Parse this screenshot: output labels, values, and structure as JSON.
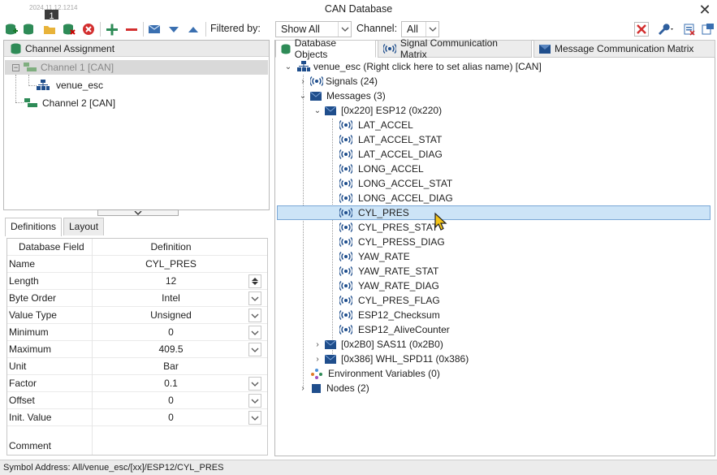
{
  "window": {
    "title": "CAN Database",
    "timestamp": "2024.11.12.1214",
    "badge": "1"
  },
  "toolbar": {
    "filtered_by_label": "Filtered by:",
    "filter_value": "Show All",
    "channel_label": "Channel:",
    "channel_value": "All"
  },
  "left": {
    "channel_assignment_title": "Channel Assignment",
    "channels": [
      {
        "label": "Channel 1 [CAN]"
      },
      {
        "label": "venue_esc"
      },
      {
        "label": "Channel 2 [CAN]"
      }
    ],
    "tabs": [
      "Definitions",
      "Layout"
    ],
    "grid_headers": [
      "Database Field",
      "Definition"
    ],
    "fields": [
      {
        "name": "Name",
        "value": "CYL_PRES"
      },
      {
        "name": "Length",
        "value": "12"
      },
      {
        "name": "Byte Order",
        "value": "Intel"
      },
      {
        "name": "Value Type",
        "value": "Unsigned"
      },
      {
        "name": "Minimum",
        "value": "0"
      },
      {
        "name": "Maximum",
        "value": "409.5"
      },
      {
        "name": "Unit",
        "value": "Bar"
      },
      {
        "name": "Factor",
        "value": "0.1"
      },
      {
        "name": "Offset",
        "value": "0"
      },
      {
        "name": "Init. Value",
        "value": "0"
      },
      {
        "name": "Comment",
        "value": ""
      }
    ]
  },
  "right": {
    "tabs": [
      "Database Objects",
      "Signal Communication Matrix",
      "Message Communication Matrix"
    ],
    "root": "venue_esc (Right click here to set alias name) [CAN]",
    "signals_node": "Signals (24)",
    "messages_node": "Messages (3)",
    "esp12": "[0x220] ESP12 (0x220)",
    "esp12_signals": [
      "LAT_ACCEL",
      "LAT_ACCEL_STAT",
      "LAT_ACCEL_DIAG",
      "LONG_ACCEL",
      "LONG_ACCEL_STAT",
      "LONG_ACCEL_DIAG",
      "CYL_PRES",
      "CYL_PRES_STAT",
      "CYL_PRESS_DIAG",
      "YAW_RATE",
      "YAW_RATE_STAT",
      "YAW_RATE_DIAG",
      "CYL_PRES_FLAG",
      "ESP12_Checksum",
      "ESP12_AliveCounter"
    ],
    "sas11": "[0x2B0] SAS11 (0x2B0)",
    "whl": "[0x386] WHL_SPD11 (0x386)",
    "env": "Environment Variables (0)",
    "nodes": "Nodes (2)"
  },
  "status": {
    "text": "Symbol Address: All/venue_esc/[xx]/ESP12/CYL_PRES"
  },
  "colors": {
    "db_green": "#2e8b57",
    "msg_blue": "#1f4e8c",
    "sel_blue": "#cce4f7",
    "cursor_yellow": "#f5c518"
  }
}
